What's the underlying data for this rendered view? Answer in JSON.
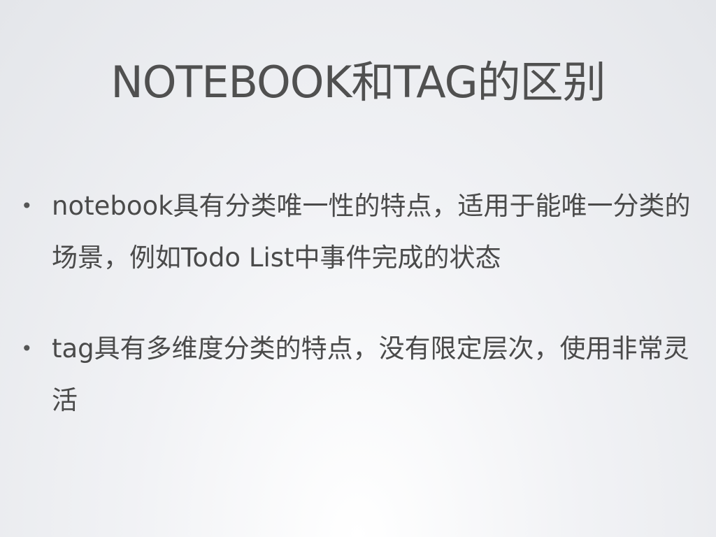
{
  "slide": {
    "title": "NOTEBOOK和TAG的区别",
    "bullets": [
      {
        "text": "notebook具有分类唯一性的特点，适用于能唯一分类的场景，例如Todo List中事件完成的状态"
      },
      {
        "text": "tag具有多维度分类的特点，没有限定层次，使用非常灵活"
      }
    ]
  }
}
